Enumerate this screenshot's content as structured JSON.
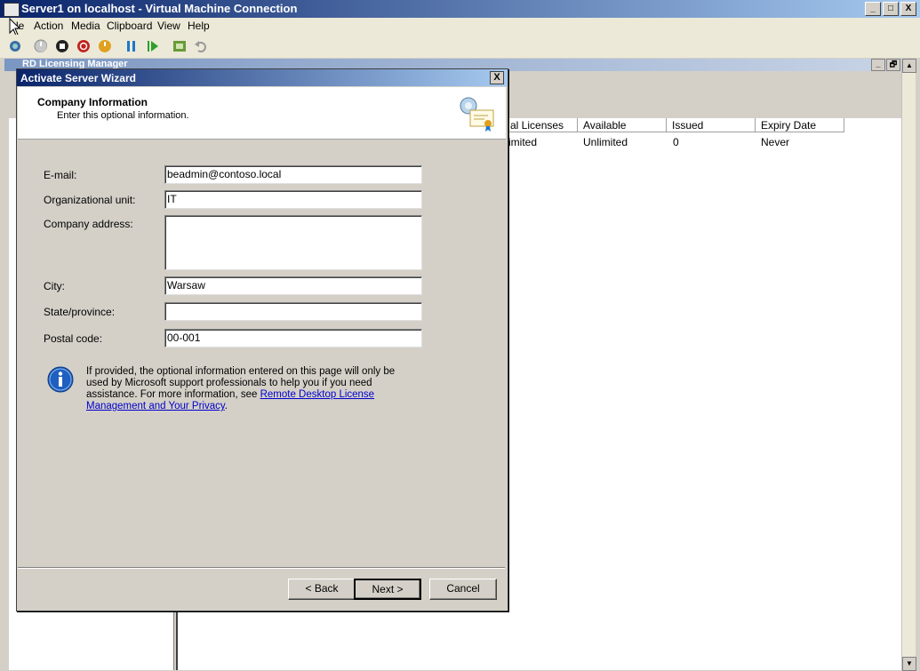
{
  "window": {
    "title": "Server1 on localhost - Virtual Machine Connection",
    "caption_buttons": [
      "_",
      "□",
      "X"
    ]
  },
  "menubar": {
    "items": [
      "File",
      "Action",
      "Media",
      "Clipboard",
      "View",
      "Help"
    ],
    "file_visible": "le"
  },
  "inner_app": {
    "title": "RD Licensing Manager",
    "caption_buttons": [
      "_",
      "🗗",
      "▲"
    ]
  },
  "license_table": {
    "columns": [
      "al Licenses",
      "Available",
      "Issued",
      "Expiry Date"
    ],
    "rows": [
      [
        "imited",
        "Unlimited",
        "0",
        "Never"
      ]
    ]
  },
  "dialog": {
    "title": "Activate Server Wizard",
    "close_label": "X",
    "header_title": "Company Information",
    "header_subtitle": "Enter this optional information.",
    "fields": {
      "email_label": "E-mail:",
      "email_value": "beadmin@contoso.local",
      "ou_label": "Organizational unit:",
      "ou_value": "IT",
      "address_label": "Company address:",
      "address_value": "",
      "city_label": "City:",
      "city_value": "Warsaw",
      "state_label": "State/province:",
      "state_value": "",
      "postal_label": "Postal code:",
      "postal_value": "00-001"
    },
    "info_text": "If provided, the optional information entered on this page will only be used by Microsoft support professionals to help you if you need assistance. For more information, see ",
    "info_link": "Remote Desktop License Management and Your Privacy",
    "info_end": ".",
    "buttons": {
      "back": "< Back",
      "next": "Next >",
      "cancel": "Cancel"
    }
  },
  "colors": {
    "titlebar_start": "#0a246a",
    "titlebar_end": "#a6caf0",
    "dialog_bg": "#d4d0c8",
    "link": "#0000cc"
  }
}
